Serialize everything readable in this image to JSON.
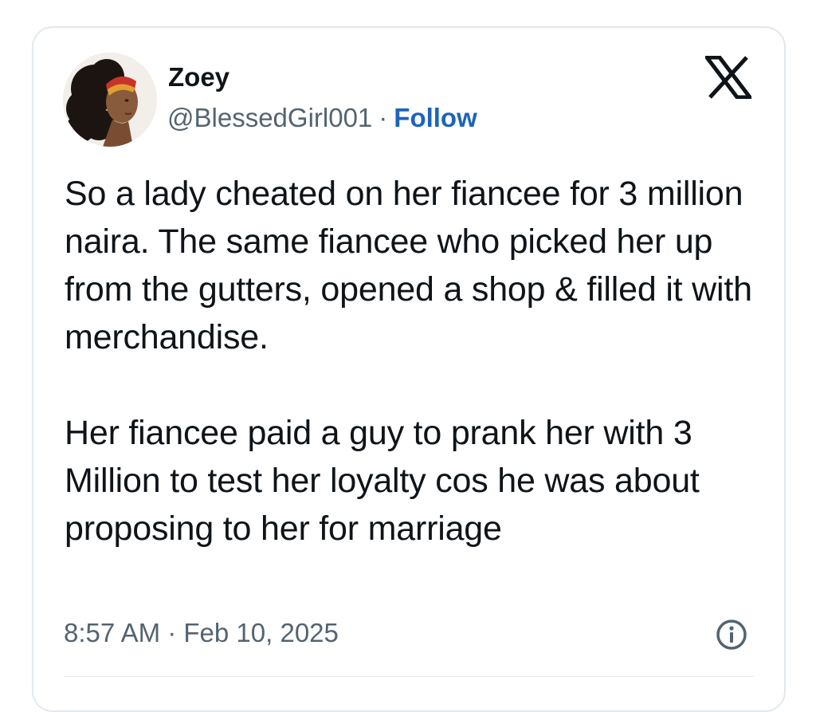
{
  "tweet": {
    "author": {
      "display_name": "Zoey",
      "handle": "@BlessedGirl001",
      "separator": "·",
      "follow_label": "Follow",
      "avatar_icon": "profile-photo"
    },
    "platform_icon": "x-logo",
    "paragraphs": [
      "So a lady cheated on her fiancee for 3 million naira. The same fiancee who picked her up from the gutters, opened a shop & filled it with merchandise.",
      "Her fiancee paid a guy to prank her with 3 Million to test her loyalty cos he was about proposing to her for marriage"
    ],
    "timestamp": "8:57 AM · Feb 10, 2025",
    "info_icon": "info-icon"
  },
  "colors": {
    "text": "#0f1419",
    "secondary_text": "#536471",
    "link": "#1d64b9",
    "border": "#e1e8ed"
  }
}
